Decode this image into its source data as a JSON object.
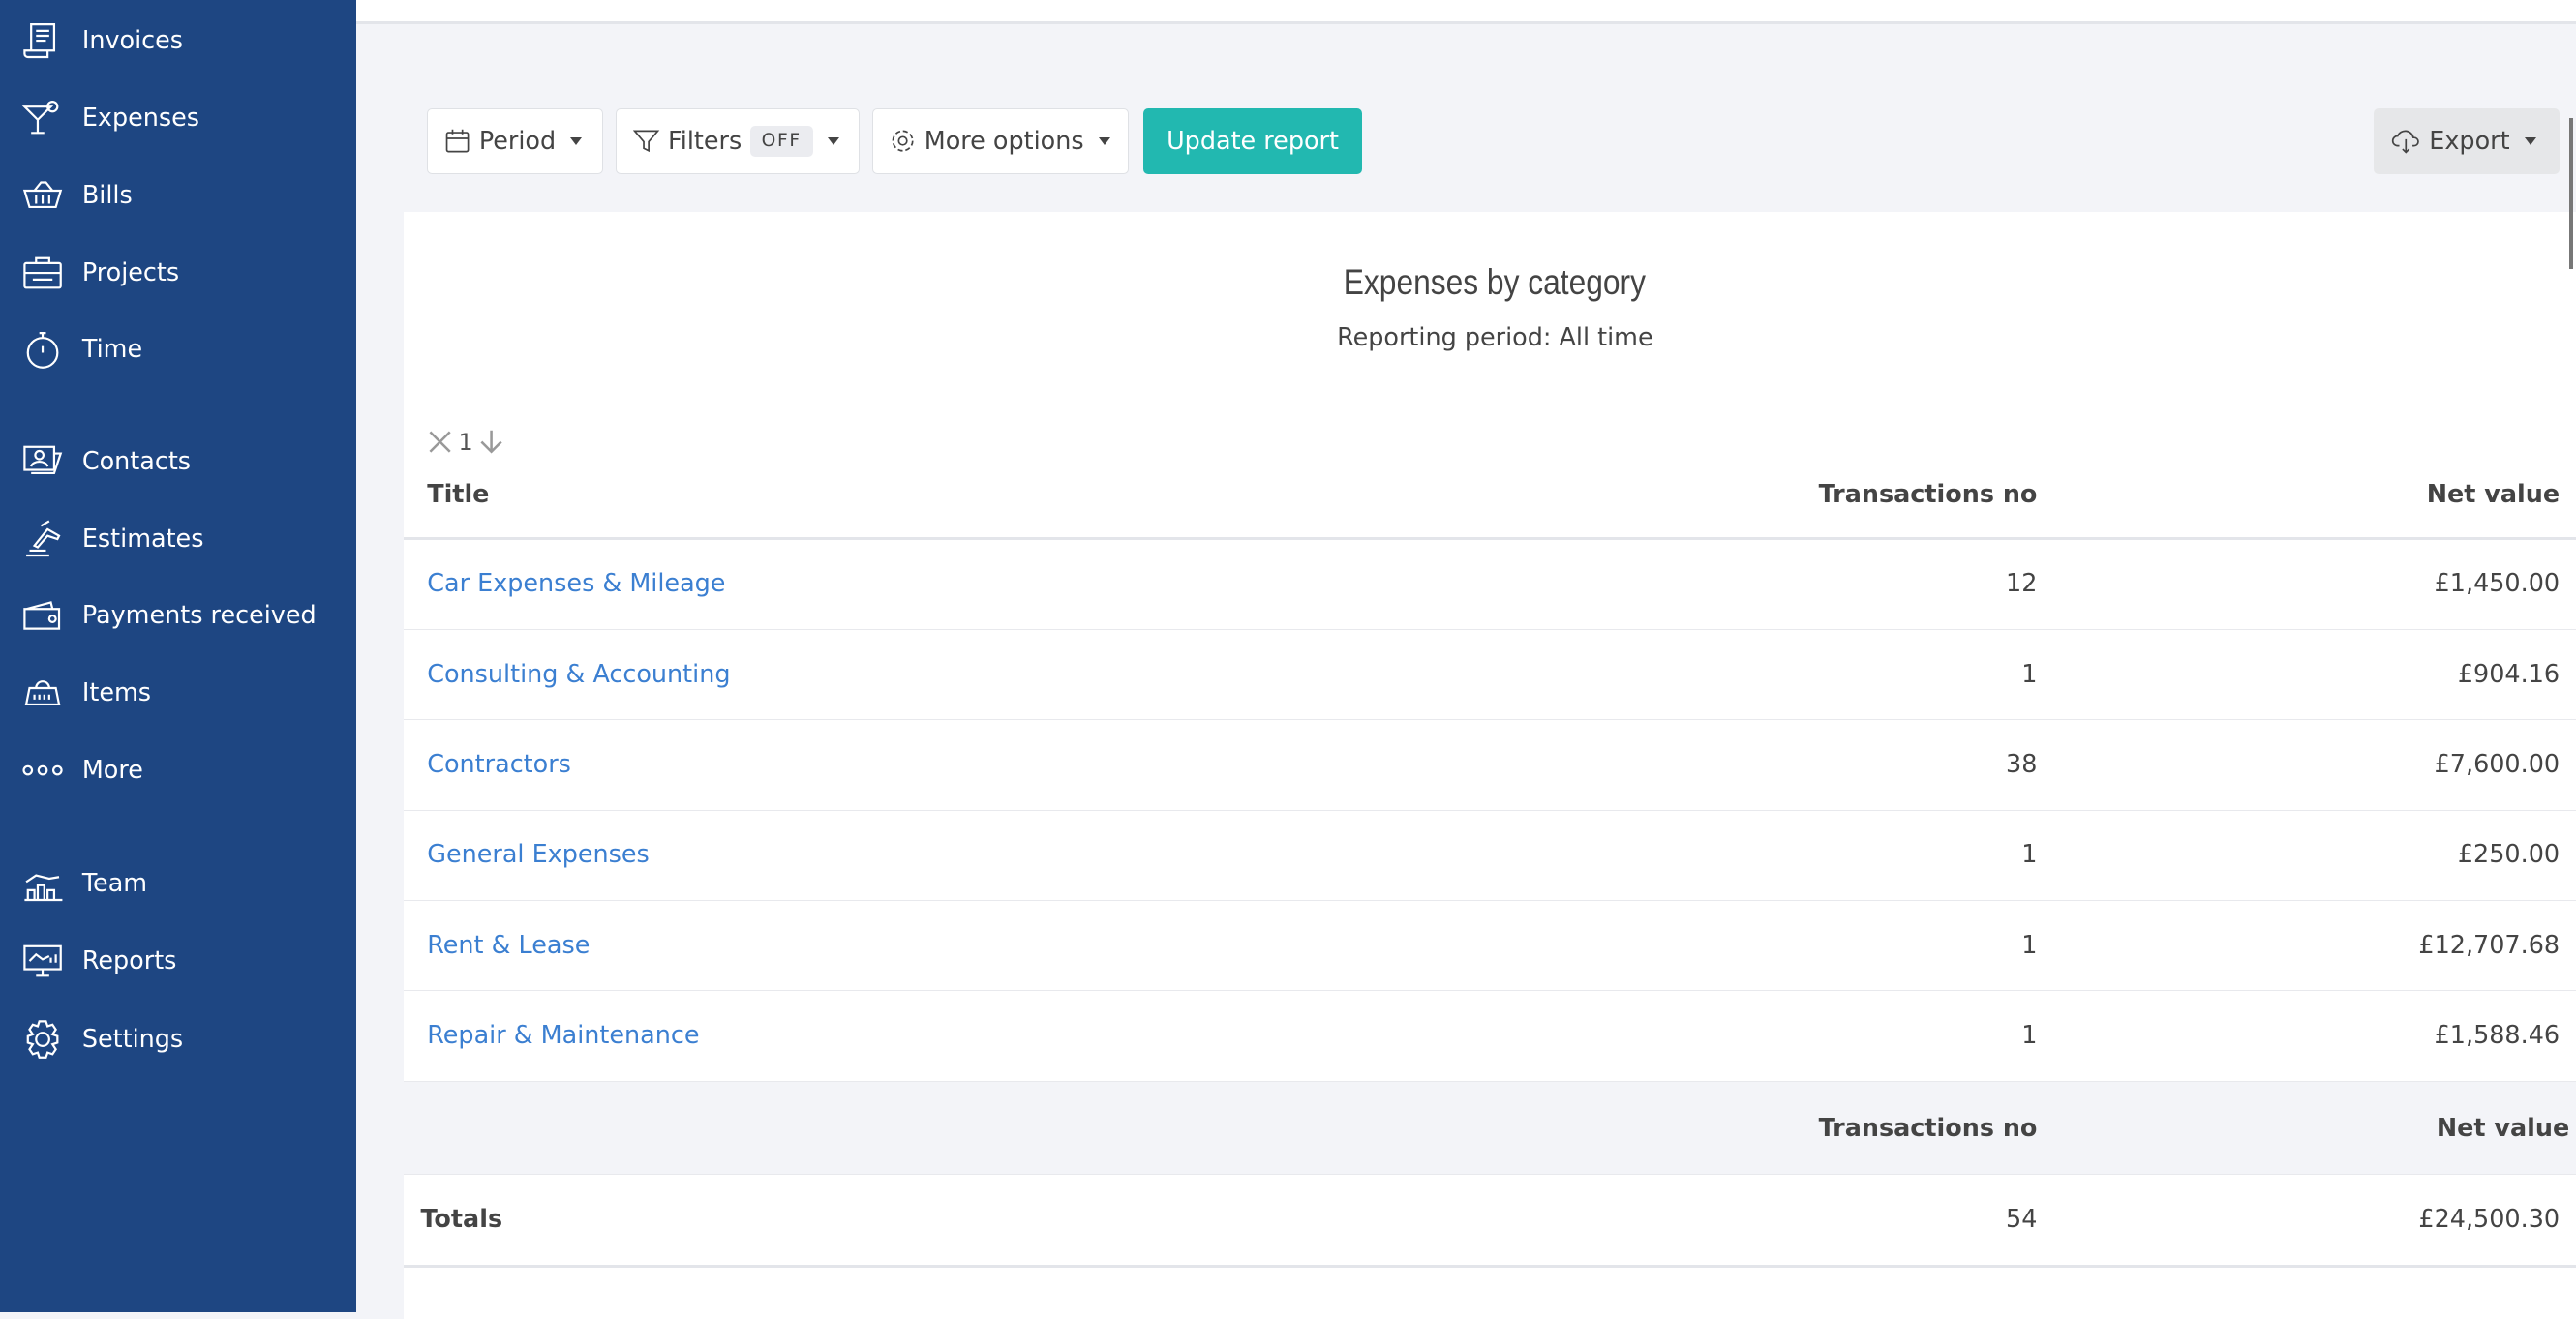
{
  "sidebar": {
    "items": [
      {
        "label": "Invoices",
        "icon": "invoice-icon"
      },
      {
        "label": "Expenses",
        "icon": "cocktail-icon"
      },
      {
        "label": "Bills",
        "icon": "basket-icon"
      },
      {
        "label": "Projects",
        "icon": "briefcase-icon"
      },
      {
        "label": "Time",
        "icon": "stopwatch-icon"
      },
      {
        "label": "Contacts",
        "icon": "contact-card-icon"
      },
      {
        "label": "Estimates",
        "icon": "gavel-icon"
      },
      {
        "label": "Payments received",
        "icon": "wallet-icon"
      },
      {
        "label": "Items",
        "icon": "items-icon"
      },
      {
        "label": "More",
        "icon": "more-dots-icon"
      },
      {
        "label": "Team",
        "icon": "team-chart-icon"
      },
      {
        "label": "Reports",
        "icon": "reports-monitor-icon"
      },
      {
        "label": "Settings",
        "icon": "gear-icon"
      }
    ]
  },
  "toolbar": {
    "period": "Period",
    "filters": "Filters",
    "filters_state": "OFF",
    "more_options": "More options",
    "update": "Update report",
    "export": "Export",
    "accent": "#22b8b0"
  },
  "report": {
    "title": "Expenses by category",
    "subtitle": "Reporting period: All time",
    "sort_level": "1",
    "columns": [
      "Title",
      "Transactions no",
      "Net value"
    ],
    "rows": [
      {
        "title": "Car Expenses & Mileage",
        "count": "12",
        "net": "£1,450.00"
      },
      {
        "title": "Consulting & Accounting",
        "count": "1",
        "net": "£904.16"
      },
      {
        "title": "Contractors",
        "count": "38",
        "net": "£7,600.00"
      },
      {
        "title": "General Expenses",
        "count": "1",
        "net": "£250.00"
      },
      {
        "title": "Rent & Lease",
        "count": "1",
        "net": "£12,707.68"
      },
      {
        "title": "Repair & Maintenance",
        "count": "1",
        "net": "£1,588.46"
      }
    ],
    "totals": {
      "label": "Totals",
      "count_header": "Transactions no",
      "net_header": "Net value",
      "count": "54",
      "net": "£24,500.30"
    }
  }
}
